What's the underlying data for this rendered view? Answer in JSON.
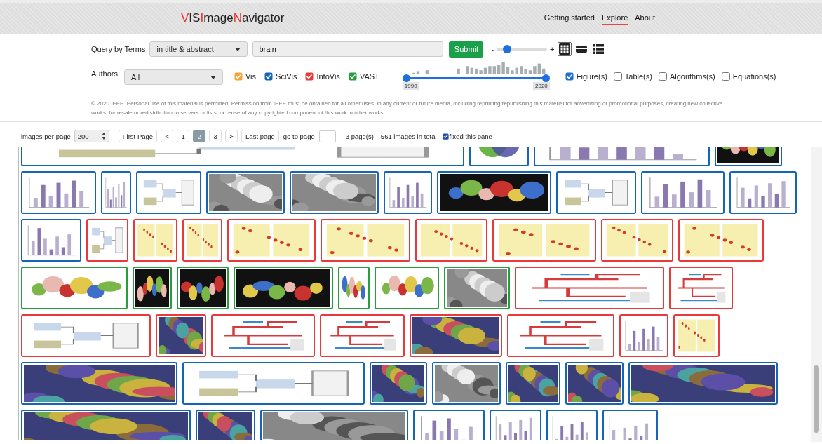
{
  "header": {
    "logo": [
      {
        "text": "V",
        "accent": true
      },
      {
        "text": "IS",
        "accent": false
      },
      {
        "text": "I",
        "accent": true
      },
      {
        "text": "mage",
        "accent": false
      },
      {
        "text": "N",
        "accent": true
      },
      {
        "text": "avigator",
        "accent": false
      }
    ],
    "nav": [
      {
        "label": "Getting started",
        "selected": false
      },
      {
        "label": "Explore",
        "selected": true
      },
      {
        "label": "About",
        "selected": false
      }
    ]
  },
  "query": {
    "label": "Query by Terms",
    "scope": "in title & abstract",
    "value": "brain",
    "submit": "Submit",
    "zoom": {
      "minus": "-",
      "plus": "+",
      "level": 0.2
    },
    "views": [
      {
        "kind": "grid",
        "selected": true
      },
      {
        "kind": "card",
        "selected": false
      },
      {
        "kind": "list",
        "selected": false
      }
    ]
  },
  "filters": {
    "authors_label": "Authors:",
    "authors": "All",
    "venues": [
      {
        "label": "Vis",
        "checked": true,
        "color": "#f5a335"
      },
      {
        "label": "SciVis",
        "checked": true,
        "color": "#1565b7"
      },
      {
        "label": "InfoVis",
        "checked": true,
        "color": "#e83a3a"
      },
      {
        "label": "VAST",
        "checked": true,
        "color": "#23a03a"
      }
    ],
    "years": {
      "from": "1990",
      "to": "2020",
      "start": {
        "level": 0
      },
      "end": {
        "level": 1
      }
    },
    "types": [
      {
        "label": "Figure(s)",
        "checked": true
      },
      {
        "label": "Table(s)",
        "checked": false
      },
      {
        "label": "Algorithms(s)",
        "checked": false
      },
      {
        "label": "Equations(s)",
        "checked": false
      }
    ]
  },
  "copyright": "© 2020 IEEE. Personal use of this material is permitted. Permission from IEEE must be obtained for all other uses, in any current or future media, including reprinting/republishing this material for advertising or promotional purposes, creating new collective works, for resale or redistribution to servers or lists, or reuse of any copyrighted component of this work in other works.",
  "pager": {
    "per_page_label": "images per page",
    "per_page": "200",
    "first": "First Page",
    "prev": "<",
    "pages": [
      {
        "label": "1",
        "selected": false
      },
      {
        "label": "2",
        "selected": true
      },
      {
        "label": "3",
        "selected": false
      }
    ],
    "next": ">",
    "last": "Last page",
    "goto_label": "go to page",
    "page_count": "3 page(s)",
    "total": "561 images in total",
    "fixed_label": "fixed this pane",
    "fixed": true
  },
  "gallery": {
    "rows": [
      [
        {
          "color": "#1565b7"
        },
        {
          "color": "#1565b7"
        },
        {
          "color": "#1565b7"
        },
        {
          "color": "#1565b7"
        }
      ],
      [
        {
          "color": "#1565b7"
        },
        {
          "color": "#1565b7"
        },
        {
          "color": "#1565b7"
        },
        {
          "color": "#1565b7"
        },
        {
          "color": "#1565b7"
        },
        {
          "color": "#1565b7"
        },
        {
          "color": "#1565b7"
        },
        {
          "color": "#1565b7"
        },
        {
          "color": "#1565b7"
        },
        {
          "color": "#1565b7"
        }
      ],
      [
        {
          "color": "#1565b7"
        },
        {
          "color": "#e83a3a"
        },
        {
          "color": "#e83a3a"
        },
        {
          "color": "#e83a3a"
        },
        {
          "color": "#e83a3a"
        },
        {
          "color": "#e83a3a"
        },
        {
          "color": "#e83a3a"
        },
        {
          "color": "#e83a3a"
        },
        {
          "color": "#e83a3a"
        },
        {
          "color": "#e83a3a"
        }
      ],
      [
        {
          "color": "#23a03a"
        },
        {
          "color": "#23a03a"
        },
        {
          "color": "#23a03a"
        },
        {
          "color": "#23a03a"
        },
        {
          "color": "#23a03a"
        },
        {
          "color": "#23a03a"
        },
        {
          "color": "#23a03a"
        },
        {
          "color": "#e83a3a"
        },
        {
          "color": "#e83a3a"
        }
      ],
      [
        {
          "color": "#e83a3a"
        },
        {
          "color": "#e83a3a"
        },
        {
          "color": "#e83a3a"
        },
        {
          "color": "#e83a3a"
        },
        {
          "color": "#e83a3a"
        },
        {
          "color": "#e83a3a"
        },
        {
          "color": "#e83a3a"
        },
        {
          "color": "#e83a3a"
        }
      ],
      [
        {
          "color": "#1565b7"
        },
        {
          "color": "#1565b7"
        },
        {
          "color": "#1565b7"
        },
        {
          "color": "#1565b7"
        },
        {
          "color": "#1565b7"
        },
        {
          "color": "#1565b7"
        },
        {
          "color": "#1565b7"
        }
      ],
      [
        {
          "color": "#1565b7"
        },
        {
          "color": "#1565b7"
        },
        {
          "color": "#1565b7"
        },
        {
          "color": "#1565b7"
        },
        {
          "color": "#1565b7"
        },
        {
          "color": "#1565b7"
        },
        {
          "color": "#1565b7"
        }
      ]
    ]
  }
}
